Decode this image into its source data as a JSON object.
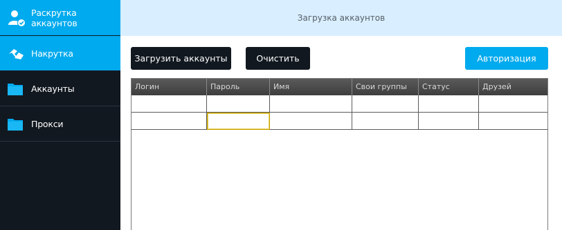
{
  "sidebar": {
    "items": [
      {
        "label": "Раскрутка аккаунтов",
        "icon": "user-check-icon"
      },
      {
        "label": "Накрутка",
        "icon": "hands-icon"
      },
      {
        "label": "Аккаунты",
        "icon": "folder-icon"
      },
      {
        "label": "Прокси",
        "icon": "folder-icon"
      }
    ]
  },
  "header": {
    "title": "Загрузка аккаунтов"
  },
  "toolbar": {
    "load_label": "Загрузить аккаунты",
    "clear_label": "Очистить",
    "auth_label": "Авторизация"
  },
  "table": {
    "columns": [
      "Логин",
      "Пароль",
      "Имя",
      "Свои группы",
      "Статус",
      "Друзей"
    ],
    "rows": [
      [
        "",
        "",
        "",
        "",
        "",
        ""
      ],
      [
        "",
        "",
        "",
        "",
        "",
        ""
      ]
    ]
  },
  "colors": {
    "accent": "#00aaee",
    "sidebar": "#121820",
    "topbar": "#d9efff"
  }
}
